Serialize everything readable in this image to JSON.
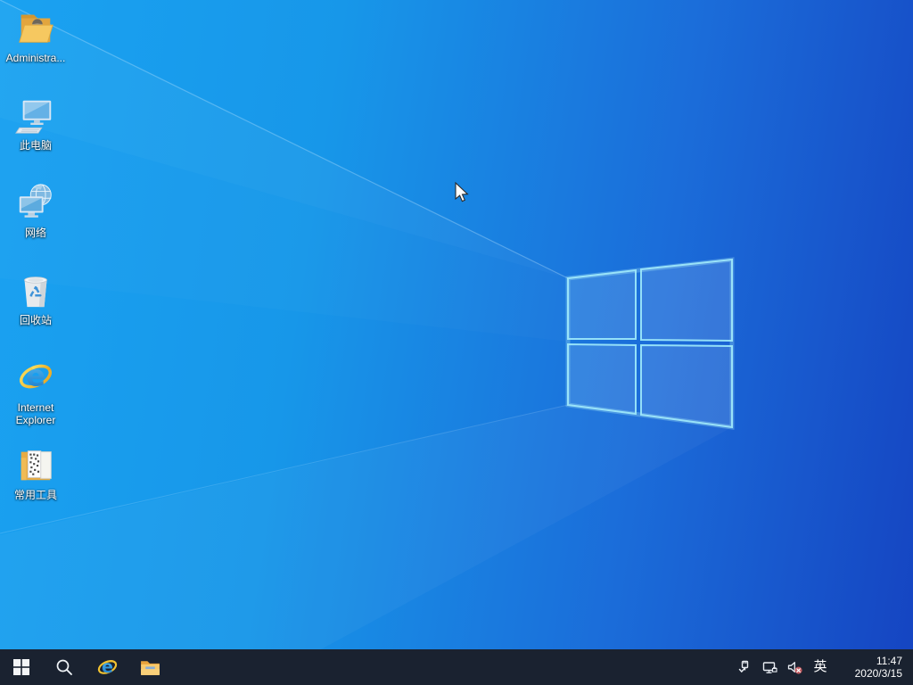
{
  "wallpaper": {
    "style": "windows-10-light-rays",
    "logo": "windows-logo"
  },
  "desktop": {
    "icons": [
      {
        "id": "administrator",
        "label": "Administra...",
        "icon": "user-folder-icon"
      },
      {
        "id": "this-pc",
        "label": "此电脑",
        "icon": "computer-icon"
      },
      {
        "id": "network",
        "label": "网络",
        "icon": "network-globe-icon"
      },
      {
        "id": "recycle-bin",
        "label": "回收站",
        "icon": "recycle-bin-icon"
      },
      {
        "id": "internet-explorer",
        "label": "Internet Explorer",
        "icon": "ie-icon"
      },
      {
        "id": "common-tools",
        "label": "常用工具",
        "icon": "tools-folder-icon"
      }
    ]
  },
  "taskbar": {
    "buttons": [
      {
        "id": "start",
        "icon": "windows-start-icon"
      },
      {
        "id": "search",
        "icon": "search-icon"
      },
      {
        "id": "internet-explorer",
        "icon": "ie-icon"
      },
      {
        "id": "file-explorer",
        "icon": "folder-icon"
      }
    ],
    "tray": {
      "icons": [
        {
          "id": "usb",
          "icon": "usb-safely-remove-icon"
        },
        {
          "id": "network",
          "icon": "network-status-icon"
        },
        {
          "id": "volume-muted",
          "icon": "speaker-muted-icon"
        }
      ],
      "language": "英",
      "time": "11:47",
      "date": "2020/3/15"
    }
  },
  "colors": {
    "wallpaper_left": "#1aa2f1",
    "wallpaper_right": "#1545c2",
    "taskbar": "#1a2230",
    "logo_border": "#9ae6fa",
    "mute_badge": "#c05a60"
  }
}
